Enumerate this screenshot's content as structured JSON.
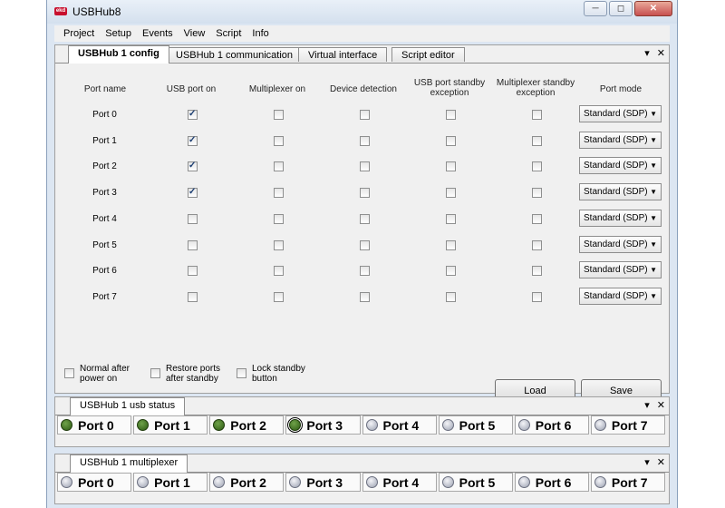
{
  "window": {
    "title": "USBHub8",
    "logo": "ekd"
  },
  "menu": [
    "Project",
    "Setup",
    "Events",
    "View",
    "Script",
    "Info"
  ],
  "config_panel": {
    "tabs": [
      "USBHub 1 config",
      "USBHub 1 communication",
      "Virtual interface",
      "Script editor"
    ],
    "active_tab": 0,
    "columns": {
      "port_name": "Port name",
      "usb_port_on": "USB port on",
      "multiplexer_on": "Multiplexer on",
      "device_detection": "Device detection",
      "usb_standby_exception": "USB port standby exception",
      "mux_standby_exception": "Multiplexer standby exception",
      "port_mode": "Port mode"
    },
    "ports": [
      {
        "name": "Port 0",
        "usb_on": true,
        "mux_on": false,
        "detect": false,
        "usb_exc": false,
        "mux_exc": false,
        "mode": "Standard (SDP)"
      },
      {
        "name": "Port 1",
        "usb_on": true,
        "mux_on": false,
        "detect": false,
        "usb_exc": false,
        "mux_exc": false,
        "mode": "Standard (SDP)"
      },
      {
        "name": "Port 2",
        "usb_on": true,
        "mux_on": false,
        "detect": false,
        "usb_exc": false,
        "mux_exc": false,
        "mode": "Standard (SDP)"
      },
      {
        "name": "Port 3",
        "usb_on": true,
        "mux_on": false,
        "detect": false,
        "usb_exc": false,
        "mux_exc": false,
        "mode": "Standard (SDP)"
      },
      {
        "name": "Port 4",
        "usb_on": false,
        "mux_on": false,
        "detect": false,
        "usb_exc": false,
        "mux_exc": false,
        "mode": "Standard (SDP)"
      },
      {
        "name": "Port 5",
        "usb_on": false,
        "mux_on": false,
        "detect": false,
        "usb_exc": false,
        "mux_exc": false,
        "mode": "Standard (SDP)"
      },
      {
        "name": "Port 6",
        "usb_on": false,
        "mux_on": false,
        "detect": false,
        "usb_exc": false,
        "mux_exc": false,
        "mode": "Standard (SDP)"
      },
      {
        "name": "Port 7",
        "usb_on": false,
        "mux_on": false,
        "detect": false,
        "usb_exc": false,
        "mux_exc": false,
        "mode": "Standard (SDP)"
      }
    ],
    "options": {
      "normal_after_power_on": {
        "label": "Normal after power on",
        "checked": false
      },
      "restore_ports": {
        "label": "Restore ports after standby",
        "checked": false
      },
      "lock_standby": {
        "label": "Lock standby button",
        "checked": false
      }
    },
    "buttons": {
      "load": "Load",
      "save": "Save"
    }
  },
  "usb_status_panel": {
    "tab": "USBHub 1 usb status",
    "ports": [
      {
        "label": "Port 0",
        "state": "on"
      },
      {
        "label": "Port 1",
        "state": "on"
      },
      {
        "label": "Port 2",
        "state": "on"
      },
      {
        "label": "Port 3",
        "state": "on-selected"
      },
      {
        "label": "Port 4",
        "state": "off"
      },
      {
        "label": "Port 5",
        "state": "off"
      },
      {
        "label": "Port 6",
        "state": "off"
      },
      {
        "label": "Port 7",
        "state": "off"
      }
    ]
  },
  "multiplexer_panel": {
    "tab": "USBHub 1 multiplexer",
    "ports": [
      {
        "label": "Port 0",
        "state": "off"
      },
      {
        "label": "Port 1",
        "state": "off"
      },
      {
        "label": "Port 2",
        "state": "off"
      },
      {
        "label": "Port 3",
        "state": "off"
      },
      {
        "label": "Port 4",
        "state": "off"
      },
      {
        "label": "Port 5",
        "state": "off"
      },
      {
        "label": "Port 6",
        "state": "off"
      },
      {
        "label": "Port 7",
        "state": "off"
      }
    ]
  },
  "panel_controls": {
    "menu_glyph": "▾",
    "close_glyph": "✕"
  },
  "colors": {
    "led_on": "#3b6e1c",
    "led_off": "#b4b8c6",
    "close_button": "#c75050"
  }
}
